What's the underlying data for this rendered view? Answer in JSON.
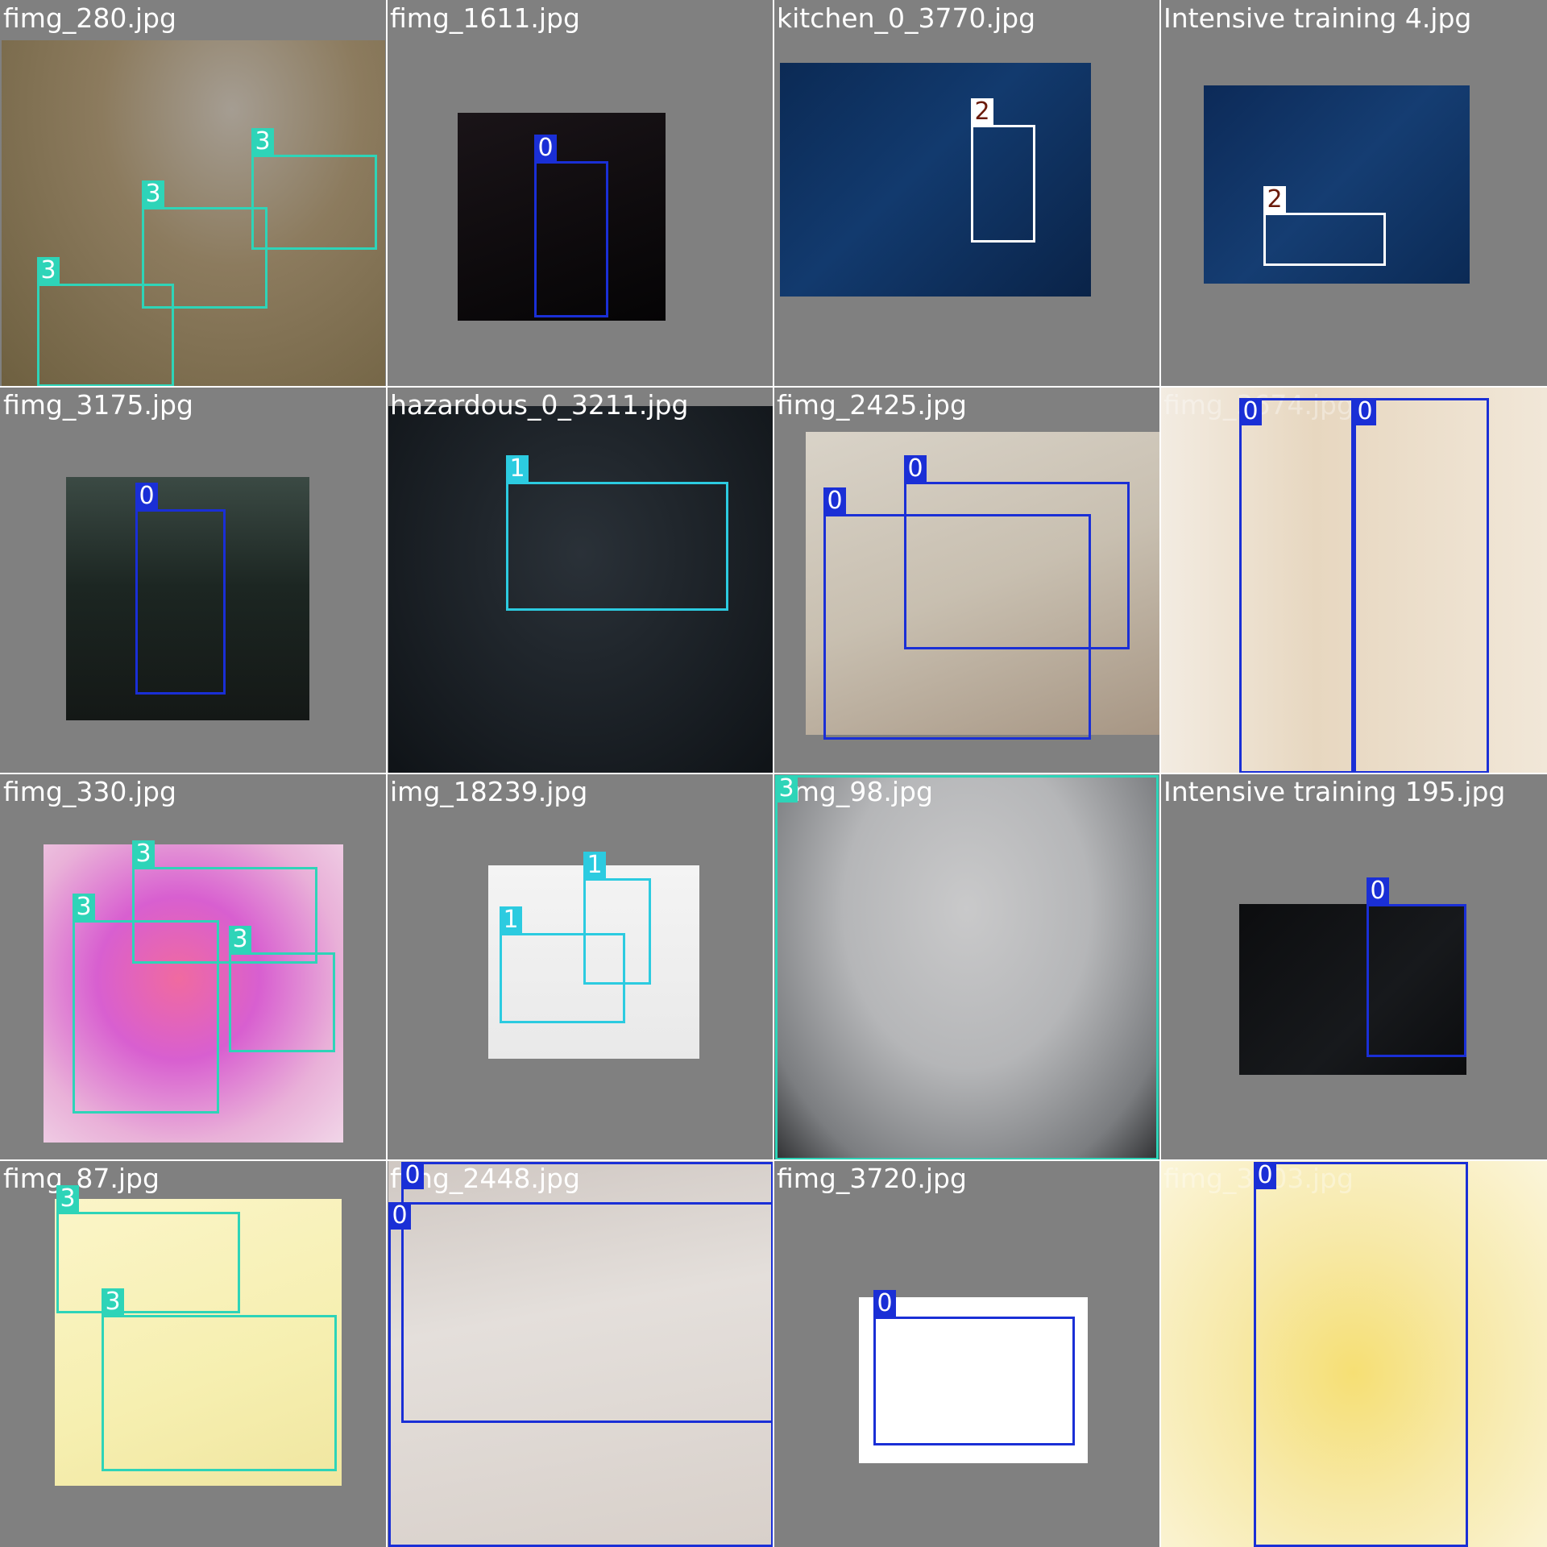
{
  "class_colors": {
    "0": "#1a2fd6",
    "1": "#2ccbe0",
    "2": "#ffffff",
    "3": "#2ed4b8"
  },
  "tiles": [
    {
      "filename": "fimg_280.jpg",
      "labels": [
        "3",
        "3",
        "3"
      ]
    },
    {
      "filename": "fimg_1611.jpg",
      "labels": [
        "0"
      ]
    },
    {
      "filename": "kitchen_0_3770.jpg",
      "labels": [
        "2"
      ]
    },
    {
      "filename": "Intensive training 4.jpg",
      "labels": [
        "2"
      ]
    },
    {
      "filename": "fimg_3175.jpg",
      "labels": [
        "0"
      ]
    },
    {
      "filename": "hazardous_0_3211.jpg",
      "labels": [
        "1"
      ]
    },
    {
      "filename": "fimg_2425.jpg",
      "labels": [
        "0",
        "0"
      ]
    },
    {
      "filename": "fimg_3674.jpg",
      "labels": [
        "0",
        "0"
      ]
    },
    {
      "filename": "fimg_330.jpg",
      "labels": [
        "3",
        "3",
        "3"
      ]
    },
    {
      "filename": "img_18239.jpg",
      "labels": [
        "1",
        "1"
      ]
    },
    {
      "filename": "fimg_98.jpg",
      "labels": [
        "3"
      ]
    },
    {
      "filename": "Intensive training 195.jpg",
      "labels": [
        "0"
      ]
    },
    {
      "filename": "fimg_87.jpg",
      "labels": [
        "3",
        "3"
      ]
    },
    {
      "filename": "fimg_2448.jpg",
      "labels": [
        "0",
        "0"
      ]
    },
    {
      "filename": "fimg_3720.jpg",
      "labels": [
        "0"
      ]
    },
    {
      "filename": "fimg_3903.jpg",
      "labels": [
        "0"
      ]
    }
  ]
}
